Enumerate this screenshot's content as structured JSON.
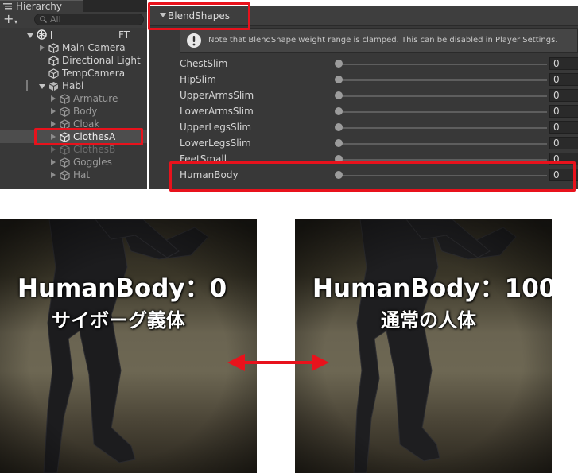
{
  "hierarchy": {
    "tab_label": "Hierarchy",
    "add_symbol": "+",
    "add_caret": "▾",
    "search_placeholder": "All",
    "scene_suffix": "FT",
    "items": [
      {
        "label": "Main Camera"
      },
      {
        "label": "Directional Light"
      },
      {
        "label": "TempCamera"
      },
      {
        "label": "Habi"
      },
      {
        "label": "Armature"
      },
      {
        "label": "Body"
      },
      {
        "label": "Cloak"
      },
      {
        "label": "ClothesA"
      },
      {
        "label": "ClothesB"
      },
      {
        "label": "Goggles"
      },
      {
        "label": "Hat"
      }
    ]
  },
  "blendshapes": {
    "section_title": "BlendShapes",
    "notice": "Note that BlendShape weight range is clamped. This can be disabled in Player Settings.",
    "rows": [
      {
        "name": "ChestSlim",
        "value": "0",
        "weight": 0
      },
      {
        "name": "HipSlim",
        "value": "0",
        "weight": 0
      },
      {
        "name": "UpperArmsSlim",
        "value": "0",
        "weight": 0
      },
      {
        "name": "LowerArmsSlim",
        "value": "0",
        "weight": 0
      },
      {
        "name": "UpperLegsSlim",
        "value": "0",
        "weight": 0
      },
      {
        "name": "LowerLegsSlim",
        "value": "0",
        "weight": 0
      },
      {
        "name": "FeetSmall",
        "value": "0",
        "weight": 0
      },
      {
        "name": "HumanBody",
        "value": "0",
        "weight": 0
      }
    ]
  },
  "comparison": {
    "left": {
      "title": "HumanBody：0",
      "subtitle": "サイボーグ義体"
    },
    "right": {
      "title": "HumanBody：100",
      "subtitle": "通常の人体"
    }
  },
  "colors": {
    "highlight": "#e8121c",
    "arrow": "#e8121c",
    "panel_bg": "#383838"
  }
}
